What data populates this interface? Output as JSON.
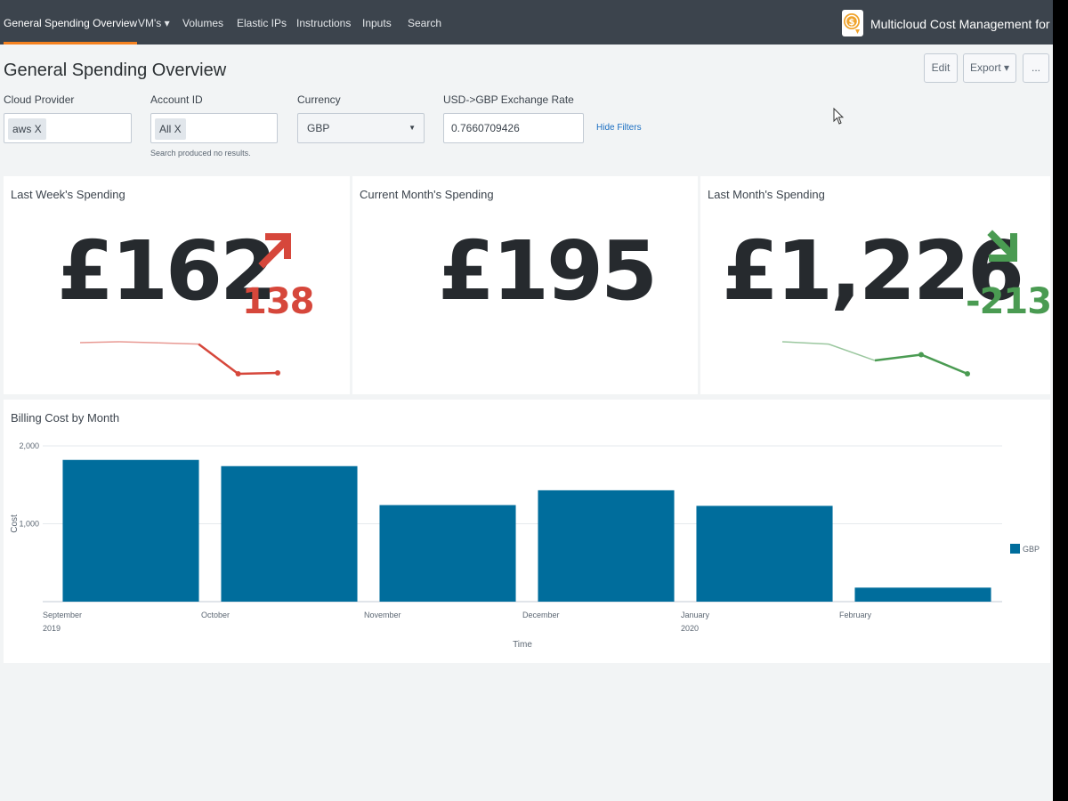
{
  "nav": {
    "tabs": [
      {
        "label": "General Spending Overview",
        "active": true
      },
      {
        "label": "VM's ▾"
      },
      {
        "label": "Volumes"
      },
      {
        "label": "Elastic IPs"
      },
      {
        "label": "Instructions"
      },
      {
        "label": "Inputs"
      },
      {
        "label": "Search"
      }
    ],
    "app_title": "Multicloud Cost Management for Splunk",
    "logo_icon": "dollar-coin-icon",
    "accent_color": "#f58220"
  },
  "page": {
    "title": "General Spending Overview",
    "buttons": {
      "edit": "Edit",
      "export": "Export ▾",
      "more": "..."
    }
  },
  "filters": {
    "cloud_provider": {
      "label": "Cloud Provider",
      "token": "aws X"
    },
    "account_id": {
      "label": "Account ID",
      "token": "All X",
      "note": "Search produced no results."
    },
    "currency": {
      "label": "Currency",
      "value": "GBP"
    },
    "exchange_rate": {
      "label": "USD->GBP Exchange Rate",
      "value": "0.7660709426"
    },
    "hide_filters": "Hide Filters"
  },
  "singles": [
    {
      "title": "Last Week's Spending",
      "value": "£162",
      "delta": "138",
      "trend": "up",
      "color": "#d6473b",
      "spark": [
        1200,
        1230,
        1190,
        1150,
        120,
        150
      ]
    },
    {
      "title": "Current Month's Spending",
      "value": "£195"
    },
    {
      "title": "Last Month's Spending",
      "value": "£1,226",
      "delta": "-213",
      "trend": "down",
      "color": "#4a9b52",
      "spark": [
        1500,
        1480,
        1340,
        1390,
        1226
      ]
    }
  ],
  "chart_data": {
    "type": "bar",
    "title": "Billing Cost by Month",
    "xlabel": "Time",
    "ylabel": "Cost",
    "categories": [
      "September 2019",
      "October",
      "November",
      "December",
      "January 2020",
      "February"
    ],
    "series": [
      {
        "name": "GBP",
        "color": "#006d9c",
        "values": [
          1820,
          1740,
          1240,
          1430,
          1230,
          180
        ]
      }
    ],
    "ylim": [
      0,
      2000
    ],
    "yticks": [
      "2,000",
      "1,000"
    ],
    "legend": "right"
  }
}
